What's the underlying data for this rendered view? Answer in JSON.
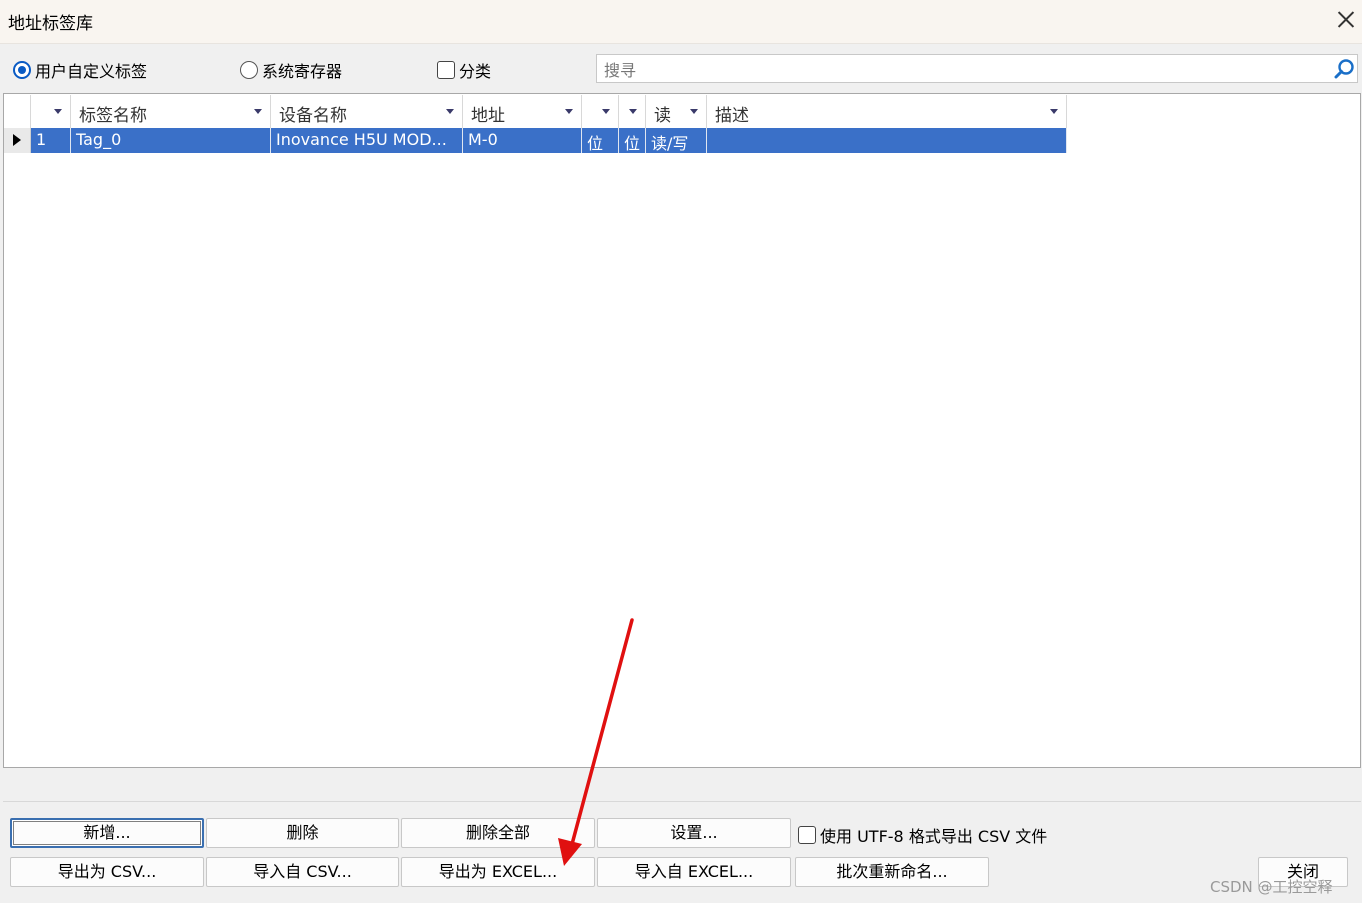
{
  "window": {
    "title": "地址标签库"
  },
  "options": {
    "radio_user": "用户自定义标签",
    "radio_system": "系统寄存器",
    "checkbox_category": "分类"
  },
  "search": {
    "placeholder": "搜寻"
  },
  "grid": {
    "headers": [
      "",
      "标签名称",
      "设备名称",
      "地址",
      "",
      "",
      "读",
      "描述"
    ],
    "rows": [
      {
        "index": "1",
        "tag": "Tag_0",
        "device": "Inovance H5U MOD...",
        "address": "M-0",
        "c5": "位",
        "c6": "位",
        "rw": "读/写",
        "desc": ""
      }
    ]
  },
  "buttons": {
    "add": "新增...",
    "delete": "删除",
    "delete_all": "删除全部",
    "settings": "设置...",
    "export_csv": "导出为 CSV...",
    "import_csv": "导入自 CSV...",
    "export_excel": "导出为 EXCEL...",
    "import_excel": "导入自 EXCEL...",
    "batch_rename": "批次重新命名...",
    "close": "关闭"
  },
  "utf8_checkbox": "使用 UTF-8 格式导出 CSV 文件",
  "watermark": "CSDN @工控空释",
  "colors": {
    "selection": "#3a70c8",
    "annotation_arrow": "#e01010"
  }
}
